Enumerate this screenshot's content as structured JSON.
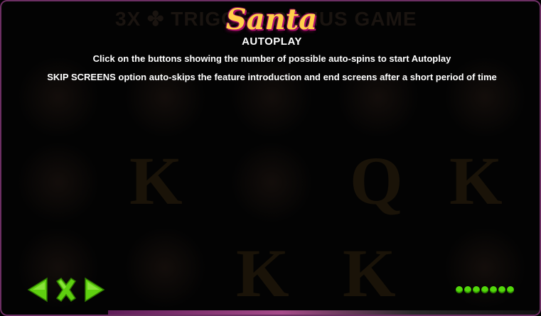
{
  "logo": {
    "text": "Santa"
  },
  "background": {
    "banner_text": "3X ✤ TRIGGER BONUS GAME"
  },
  "page": {
    "title": "AUTOPLAY",
    "line1": "Click on the buttons showing the number of possible auto-spins to start Autoplay",
    "line2": "SKIP SCREENS option auto-skips the feature introduction and end screens after a short period of time"
  },
  "nav": {
    "prev_icon": "arrow-left-icon",
    "close_icon": "close-icon",
    "next_icon": "arrow-right-icon"
  },
  "pagination": {
    "total_pages": 7,
    "current_page": 7
  },
  "colors": {
    "accent_green": "#52d80a",
    "frame_purple": "#6c2f63",
    "logo_gold": "#ffd04a",
    "logo_pink": "#b1106e"
  }
}
